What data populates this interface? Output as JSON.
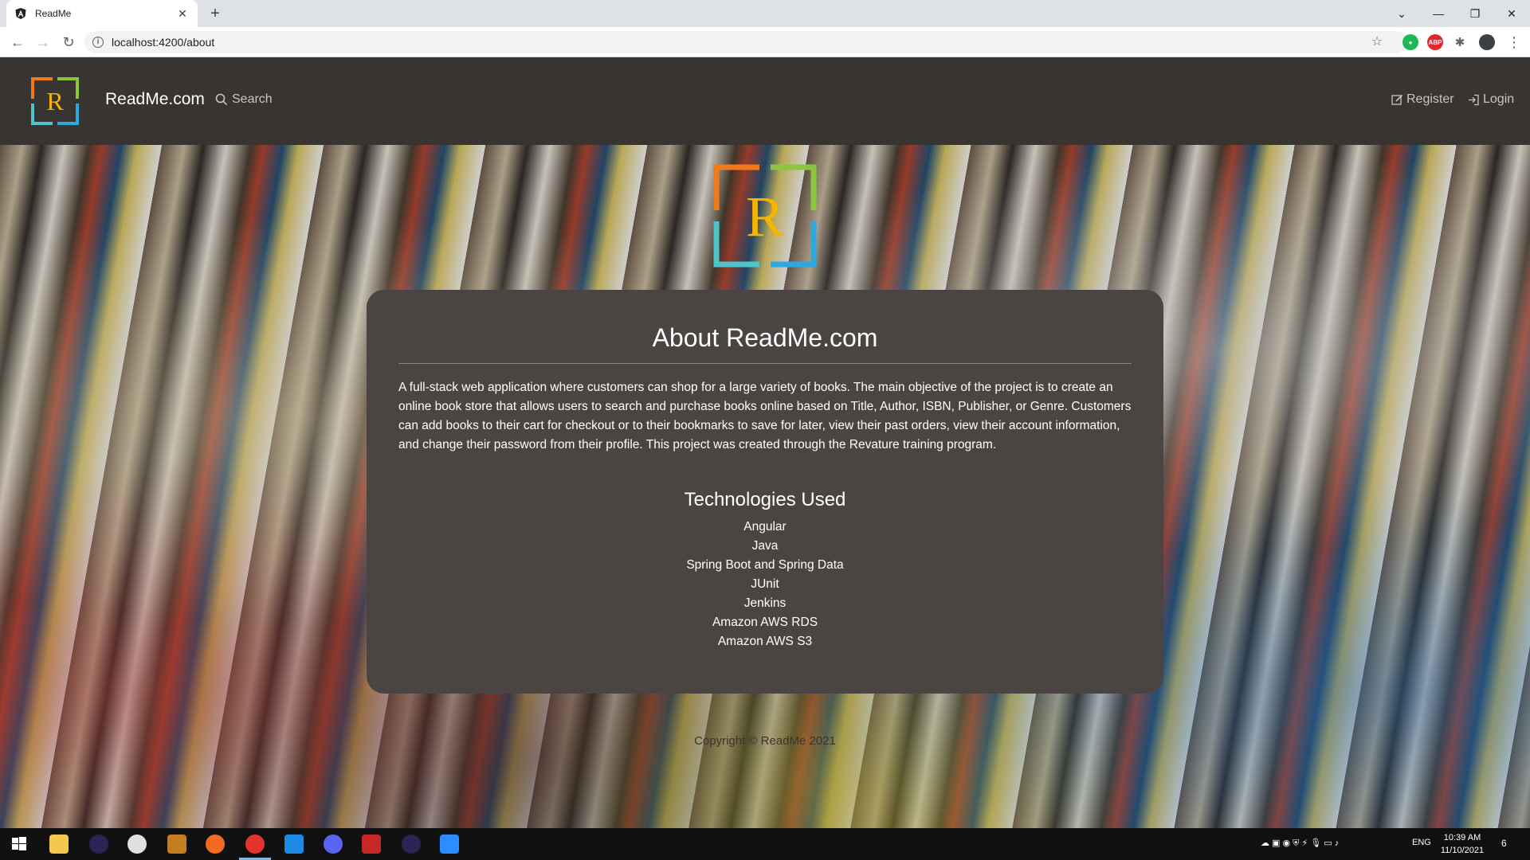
{
  "browser": {
    "tab_title": "ReadMe",
    "new_tab": "+",
    "url": "localhost:4200/about"
  },
  "navbar": {
    "logo_letter": "R",
    "brand": "ReadMe.com",
    "search_label": "Search",
    "register_label": "Register",
    "login_label": "Login"
  },
  "hero": {
    "logo_letter": "R"
  },
  "about": {
    "title": "About ReadMe.com",
    "description": "A full-stack web application where customers can shop for a large variety of books. The main objective of the project is to create an online book store that allows users to search and purchase books online based on Title, Author, ISBN, Publisher, or Genre. Customers can add books to their cart for checkout or to their bookmarks to save for later, view their past orders, view their account information, and change their password from their profile. This project was created through the Revature training program.",
    "tech_heading": "Technologies Used",
    "technologies": [
      "Angular",
      "Java",
      "Spring Boot and Spring Data",
      "JUnit",
      "Jenkins",
      "Amazon AWS RDS",
      "Amazon AWS S3"
    ]
  },
  "footer": {
    "copyright": "Copyright © ReadMe 2021"
  },
  "taskbar": {
    "language": "ENG",
    "time": "10:39 AM",
    "date": "11/10/2021",
    "notification_count": "6"
  },
  "colors": {
    "navbar_bg": "#383431",
    "card_bg": "#4a4542",
    "logo_orange": "#f07a1a",
    "logo_green": "#8cc63f",
    "logo_teal": "#4fc3c8",
    "logo_blue": "#2ea8df",
    "logo_letter": "#f5b400"
  }
}
